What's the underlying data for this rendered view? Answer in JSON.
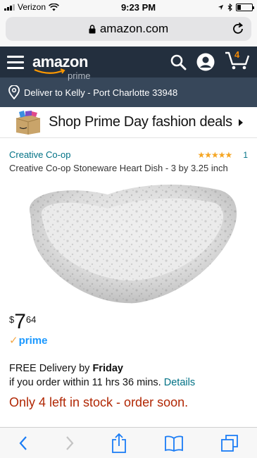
{
  "status_bar": {
    "carrier": "Verizon",
    "time": "9:23 PM"
  },
  "browser": {
    "url": "amazon.com"
  },
  "header": {
    "logo": "amazon",
    "logo_sub": "prime",
    "cart_count": "4"
  },
  "deliver": {
    "text": "Deliver to Kelly - Port Charlotte 33948"
  },
  "promo": {
    "text": "Shop Prime Day fashion deals"
  },
  "product": {
    "brand": "Creative Co-op",
    "rating": 5,
    "stars": "★★★★★",
    "review_count": "1",
    "title": "Creative Co-op Stoneware Heart Dish - 3 by 3.25 inch",
    "price_symbol": "$",
    "price_whole": "7",
    "price_fraction": "64",
    "prime_label": "prime"
  },
  "delivery": {
    "prefix": "FREE Delivery by ",
    "day": "Friday",
    "line2": "if you order within 11 hrs 36 mins.",
    "details_link": "Details"
  },
  "stock": {
    "text": "Only 4 left in stock - order soon."
  },
  "colors": {
    "header": "#232f3e",
    "deliver_bar": "#37475a",
    "link": "#007185",
    "stock": "#b12704",
    "prime": "#1a98ff"
  }
}
